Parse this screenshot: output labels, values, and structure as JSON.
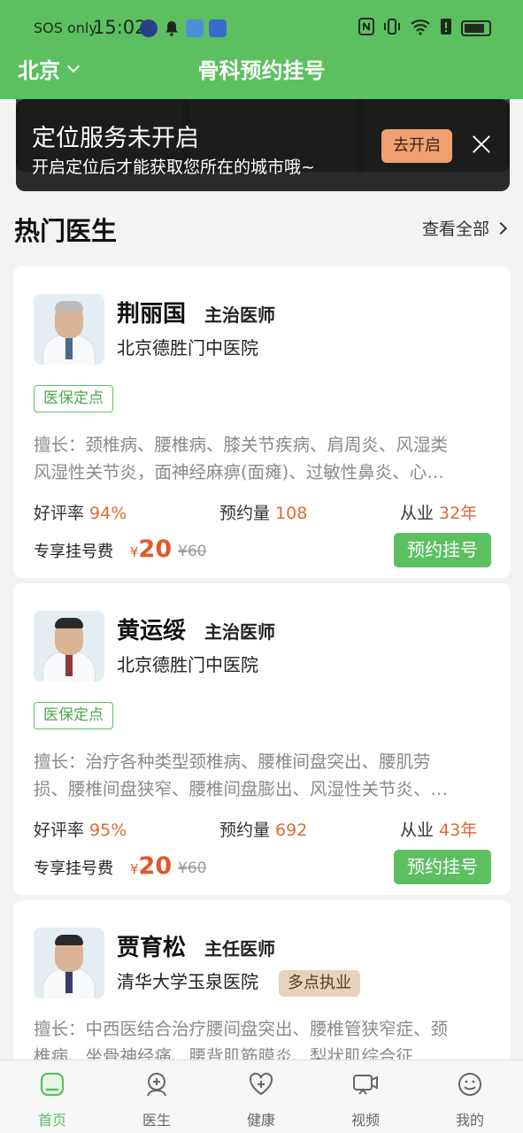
{
  "status_bar": {
    "carrier": "SOS only",
    "time": "15:02"
  },
  "header": {
    "city": "北京",
    "title": "骨科预约挂号"
  },
  "banner": {
    "title": "定位服务未开启",
    "subtitle": "开启定位后才能获取您所在的城市哦~",
    "open_button": "去开启"
  },
  "section": {
    "title": "热门医生",
    "more": "查看全部"
  },
  "labels": {
    "good_rate": "好评率",
    "appointments": "预约量",
    "practice": "从业",
    "exclusive_fee": "专享挂号费",
    "currency": "¥",
    "book_button": "预约挂号"
  },
  "doctors": [
    {
      "name": "荆丽国",
      "title": "主治医师",
      "hospital": "北京德胜门中医院",
      "tag": "医保定点",
      "skill_line1": "擅长：颈椎病、腰椎病、膝关节疾病、肩周炎、风湿类",
      "skill_line2": "风湿性关节炎，面神经麻痹(面瘫)、过敏性鼻炎、心…",
      "good_rate": "94%",
      "appointments": "108",
      "years": "32年",
      "price": "20",
      "original_price": "¥60"
    },
    {
      "name": "黄运绥",
      "title": "主治医师",
      "hospital": "北京德胜门中医院",
      "tag": "医保定点",
      "skill_line1": "擅长：治疗各种类型颈椎病、腰椎间盘突出、腰肌劳",
      "skill_line2": "损、腰椎间盘狭窄、腰椎间盘膨出、风湿性关节炎、…",
      "good_rate": "95%",
      "appointments": "692",
      "years": "43年",
      "price": "20",
      "original_price": "¥60"
    },
    {
      "name": "贾育松",
      "title": "主任医师",
      "hospital": "清华大学玉泉医院",
      "badge": "多点执业",
      "skill_line1": "擅长：中西医结合治疗腰间盘突出、腰椎管狭窄症、颈",
      "skill_line2": "椎病、坐骨神经痛、腰背肌筋膜炎、梨状肌综合征"
    }
  ],
  "nav": {
    "items": [
      {
        "label": "首页",
        "icon": "home-icon"
      },
      {
        "label": "医生",
        "icon": "doctor-icon"
      },
      {
        "label": "健康",
        "icon": "heart-plus-icon"
      },
      {
        "label": "视频",
        "icon": "video-icon"
      },
      {
        "label": "我的",
        "icon": "profile-icon"
      }
    ],
    "active_color": "#5cc060"
  },
  "colors": {
    "brand": "#5cc060",
    "accent": "#e06a32"
  }
}
